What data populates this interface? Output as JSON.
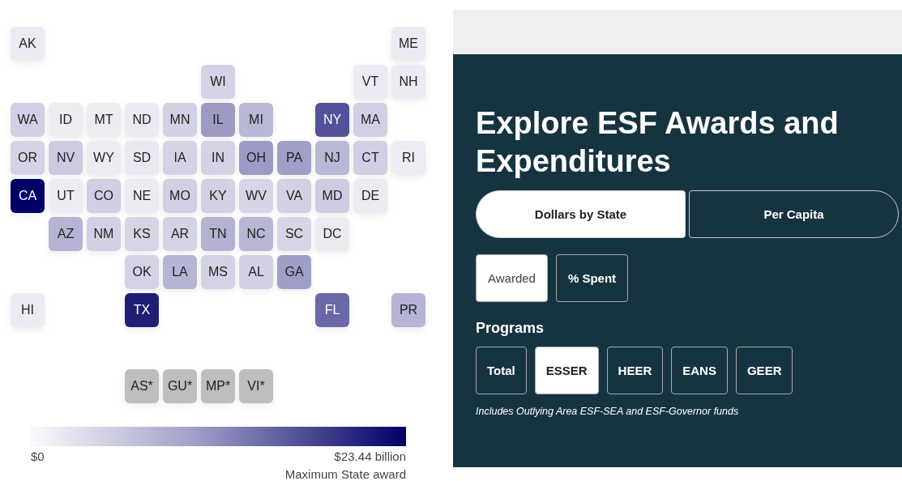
{
  "map": {
    "rows": [
      [
        {
          "code": "AK",
          "color": "#ebebf3"
        },
        null,
        null,
        null,
        null,
        null,
        null,
        null,
        null,
        null,
        {
          "code": "ME",
          "color": "#ebebf3"
        }
      ],
      [
        null,
        null,
        null,
        null,
        null,
        {
          "code": "WI",
          "color": "#d4d3e5"
        },
        null,
        null,
        null,
        {
          "code": "VT",
          "color": "#ebebf3"
        },
        {
          "code": "NH",
          "color": "#ebebf3"
        }
      ],
      [
        {
          "code": "WA",
          "color": "#d0cfe3"
        },
        {
          "code": "ID",
          "color": "#ececf3"
        },
        {
          "code": "MT",
          "color": "#ececf3"
        },
        {
          "code": "ND",
          "color": "#ebebf3"
        },
        {
          "code": "MN",
          "color": "#d2d1e4"
        },
        {
          "code": "IL",
          "color": "#9c9bc4"
        },
        {
          "code": "MI",
          "color": "#b8b7d6"
        },
        null,
        {
          "code": "NY",
          "color": "#52519a"
        },
        {
          "code": "MA",
          "color": "#d0cfe3"
        }
      ],
      [
        {
          "code": "OR",
          "color": "#d4d3e6"
        },
        {
          "code": "NV",
          "color": "#cbcadf"
        },
        {
          "code": "WY",
          "color": "#ececf3"
        },
        {
          "code": "SD",
          "color": "#e9e9f1"
        },
        {
          "code": "IA",
          "color": "#d4d3e5"
        },
        {
          "code": "IN",
          "color": "#d4d3e5"
        },
        {
          "code": "OH",
          "color": "#9c9bc5"
        },
        {
          "code": "PA",
          "color": "#a09fc8"
        },
        {
          "code": "NJ",
          "color": "#b9b8d6"
        },
        {
          "code": "CT",
          "color": "#d0cfe3"
        },
        {
          "code": "RI",
          "color": "#ededf3"
        }
      ],
      [
        {
          "code": "CA",
          "color": "#000066"
        },
        {
          "code": "UT",
          "color": "#ececf3"
        },
        {
          "code": "CO",
          "color": "#cfcee2"
        },
        {
          "code": "NE",
          "color": "#ebebf2"
        },
        {
          "code": "MO",
          "color": "#d0cfe3"
        },
        {
          "code": "KY",
          "color": "#d2d1e4"
        },
        {
          "code": "WV",
          "color": "#d6d5e6"
        },
        {
          "code": "VA",
          "color": "#d2d1e4"
        },
        {
          "code": "MD",
          "color": "#cdcce1"
        },
        {
          "code": "DE",
          "color": "#ebebf2"
        }
      ],
      [
        null,
        {
          "code": "AZ",
          "color": "#b5b4d4"
        },
        {
          "code": "NM",
          "color": "#d2d1e4"
        },
        {
          "code": "KS",
          "color": "#d6d5e6"
        },
        {
          "code": "AR",
          "color": "#d4d3e5"
        },
        {
          "code": "TN",
          "color": "#b3b2d3"
        },
        {
          "code": "NC",
          "color": "#b7b6d5"
        },
        {
          "code": "SC",
          "color": "#d6d5e6"
        },
        {
          "code": "DC",
          "color": "#ebebf2"
        }
      ],
      [
        null,
        null,
        null,
        {
          "code": "OK",
          "color": "#d4d3e5"
        },
        {
          "code": "LA",
          "color": "#b5b4d4"
        },
        {
          "code": "MS",
          "color": "#d4d3e5"
        },
        {
          "code": "AL",
          "color": "#d3d2e4"
        },
        {
          "code": "GA",
          "color": "#9f9ec6"
        }
      ],
      [
        {
          "code": "HI",
          "color": "#ebebf3"
        },
        null,
        null,
        {
          "code": "TX",
          "color": "#201e73"
        },
        null,
        null,
        null,
        null,
        {
          "code": "FL",
          "color": "#6a68a6"
        },
        null,
        {
          "code": "PR",
          "color": "#b5b4d4"
        }
      ]
    ],
    "territories": [
      {
        "code": "AS*",
        "color": "#bebebe"
      },
      {
        "code": "GU*",
        "color": "#bebebe"
      },
      {
        "code": "MP*",
        "color": "#bebebe"
      },
      {
        "code": "VI*",
        "color": "#bebebe"
      }
    ]
  },
  "legend": {
    "min": "$0",
    "max": "$23.44 billion",
    "caption": "Maximum State award"
  },
  "panel": {
    "title": "Explore ESF Awards and Expenditures",
    "views": [
      {
        "label": "Dollars by State",
        "selected": true
      },
      {
        "label": "Per Capita",
        "selected": false
      }
    ],
    "measures": [
      {
        "label": "Awarded",
        "selected": true
      },
      {
        "label": "% Spent",
        "selected": false
      }
    ],
    "programs_heading": "Programs",
    "programs": [
      {
        "label": "Total",
        "selected": false
      },
      {
        "label": "ESSER",
        "selected": true
      },
      {
        "label": "HEER",
        "selected": false
      },
      {
        "label": "EANS",
        "selected": false
      },
      {
        "label": "GEER",
        "selected": false
      }
    ],
    "note": "Includes Outlying Area ESF-SEA and ESF-Governor funds"
  }
}
